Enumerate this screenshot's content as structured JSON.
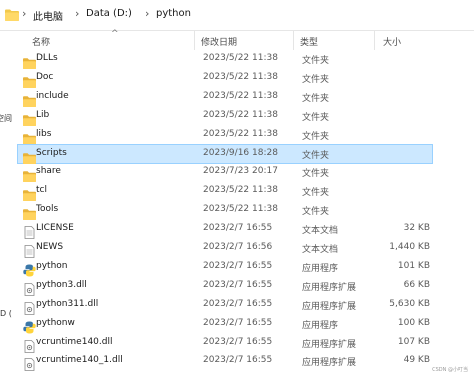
{
  "addressbar": {
    "crumbs": [
      "此电脑",
      "Data (D:)",
      "python"
    ],
    "separator": "›"
  },
  "left_fragments": [
    "空间",
    "D ("
  ],
  "columns": {
    "name": "名称",
    "modified": "修改日期",
    "type": "类型",
    "size": "大小"
  },
  "files": [
    {
      "name": "DLLs",
      "modified": "2023/5/22 11:38",
      "type": "文件夹",
      "size": "",
      "icon": "folder-icon"
    },
    {
      "name": "Doc",
      "modified": "2023/5/22 11:38",
      "type": "文件夹",
      "size": "",
      "icon": "folder-icon"
    },
    {
      "name": "include",
      "modified": "2023/5/22 11:38",
      "type": "文件夹",
      "size": "",
      "icon": "folder-icon"
    },
    {
      "name": "Lib",
      "modified": "2023/5/22 11:38",
      "type": "文件夹",
      "size": "",
      "icon": "folder-icon"
    },
    {
      "name": "libs",
      "modified": "2023/5/22 11:38",
      "type": "文件夹",
      "size": "",
      "icon": "folder-icon"
    },
    {
      "name": "Scripts",
      "modified": "2023/9/16 18:28",
      "type": "文件夹",
      "size": "",
      "icon": "folder-icon",
      "selected": true
    },
    {
      "name": "share",
      "modified": "2023/7/23 20:17",
      "type": "文件夹",
      "size": "",
      "icon": "folder-icon"
    },
    {
      "name": "tcl",
      "modified": "2023/5/22 11:38",
      "type": "文件夹",
      "size": "",
      "icon": "folder-icon"
    },
    {
      "name": "Tools",
      "modified": "2023/5/22 11:38",
      "type": "文件夹",
      "size": "",
      "icon": "folder-icon"
    },
    {
      "name": "LICENSE",
      "modified": "2023/2/7 16:55",
      "type": "文本文档",
      "size": "32 KB",
      "icon": "text-file-icon"
    },
    {
      "name": "NEWS",
      "modified": "2023/2/7 16:56",
      "type": "文本文档",
      "size": "1,440 KB",
      "icon": "text-file-icon"
    },
    {
      "name": "python",
      "modified": "2023/2/7 16:55",
      "type": "应用程序",
      "size": "101 KB",
      "icon": "python-app-icon"
    },
    {
      "name": "python3.dll",
      "modified": "2023/2/7 16:55",
      "type": "应用程序扩展",
      "size": "66 KB",
      "icon": "dll-file-icon"
    },
    {
      "name": "python311.dll",
      "modified": "2023/2/7 16:55",
      "type": "应用程序扩展",
      "size": "5,630 KB",
      "icon": "dll-file-icon"
    },
    {
      "name": "pythonw",
      "modified": "2023/2/7 16:55",
      "type": "应用程序",
      "size": "100 KB",
      "icon": "python-app-icon"
    },
    {
      "name": "vcruntime140.dll",
      "modified": "2023/2/7 16:55",
      "type": "应用程序扩展",
      "size": "107 KB",
      "icon": "dll-file-icon"
    },
    {
      "name": "vcruntime140_1.dll",
      "modified": "2023/2/7 16:55",
      "type": "应用程序扩展",
      "size": "49 KB",
      "icon": "dll-file-icon"
    }
  ],
  "watermark": "CSDN @小叮当"
}
